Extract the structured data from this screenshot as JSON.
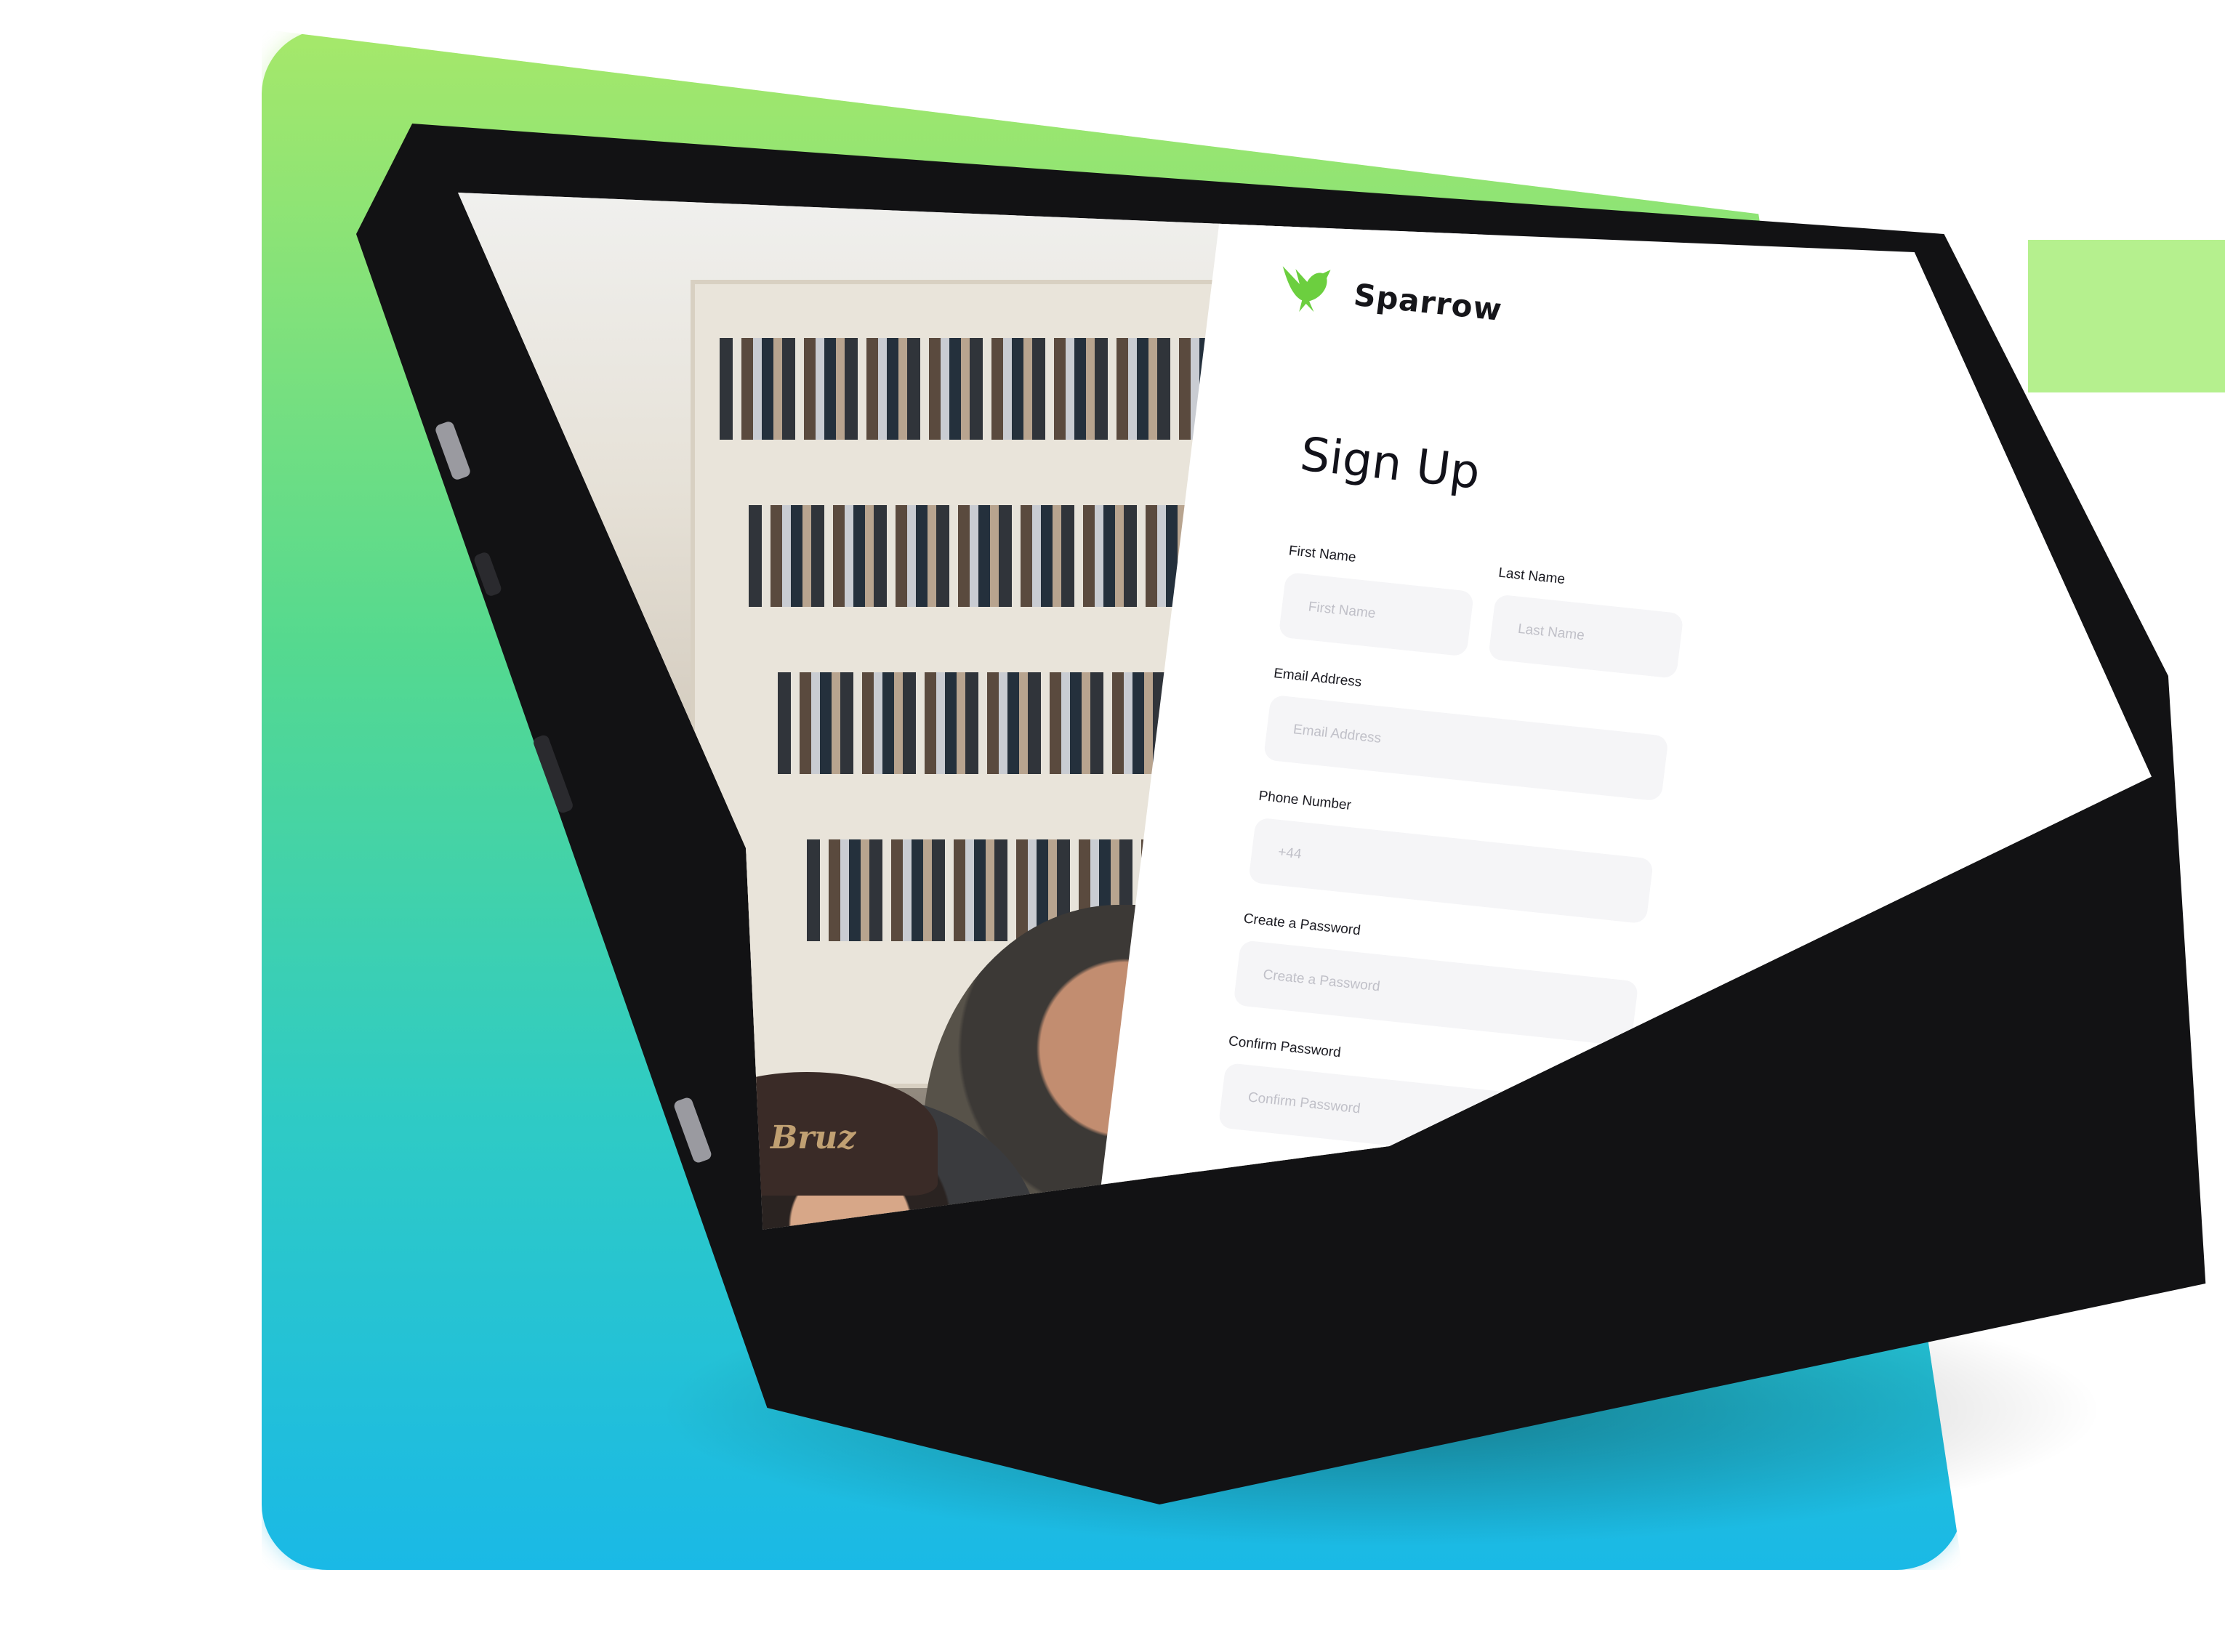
{
  "brand": {
    "name": "Sparrow",
    "logo_icon": "sparrow-bird-icon",
    "accent_color": "#7ed957"
  },
  "page": {
    "title": "Sign Up"
  },
  "form": {
    "first_name": {
      "label": "First Name",
      "placeholder": "First Name"
    },
    "last_name": {
      "label": "Last Name",
      "placeholder": "Last Name"
    },
    "email": {
      "label": "Email Address",
      "placeholder": "Email Address"
    },
    "phone": {
      "label": "Phone Number",
      "placeholder": "+44"
    },
    "password": {
      "label": "Create a Password",
      "placeholder": "Create a Password"
    },
    "confirm_password": {
      "label": "Confirm Password",
      "placeholder": "Confirm Password"
    }
  },
  "photo": {
    "cap_text": "Bruz"
  },
  "colors": {
    "gradient_top": "#a6e86a",
    "gradient_bottom": "#1ab9e6",
    "device": "#121214"
  }
}
